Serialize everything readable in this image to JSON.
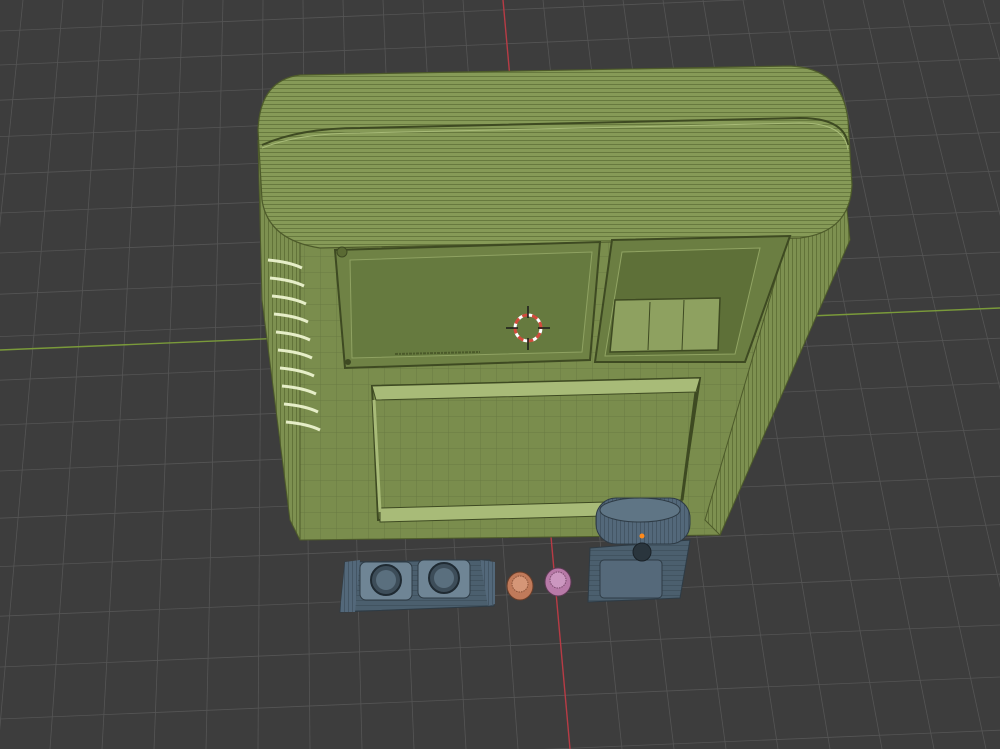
{
  "viewport": {
    "background": "#3d3d3d",
    "grid_color": "#555555",
    "x_axis_color": "#7a9a3a",
    "y_axis_color": "#b83b45"
  },
  "scene": {
    "body_color": "#7d9050",
    "body_light": "#9cae6c",
    "body_dark": "#4d5a2a",
    "part_color": "#4b5f6e",
    "part_light": "#6f8595",
    "orange_knob_color": "#c07a5a",
    "pink_knob_color": "#b87aa8",
    "pivot_color": "#d24b3c",
    "origin_dot_color": "#ff8a1a"
  }
}
